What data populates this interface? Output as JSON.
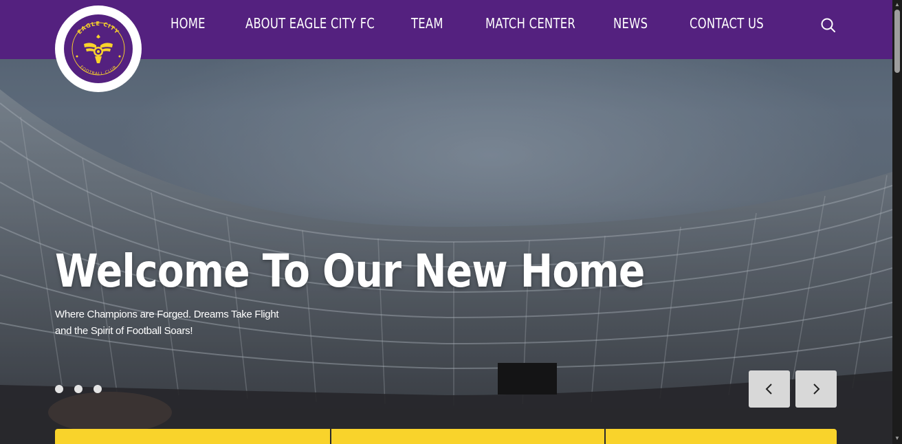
{
  "brand": {
    "name_top": "EAGLE CITY",
    "name_bottom": "FOOTBALL CLUB",
    "colors": {
      "primary": "#54217f",
      "accent": "#f9d32b"
    }
  },
  "nav": {
    "items": [
      {
        "label": "HOME"
      },
      {
        "label": "ABOUT EAGLE CITY FC"
      },
      {
        "label": "TEAM"
      },
      {
        "label": "MATCH CENTER"
      },
      {
        "label": "NEWS"
      },
      {
        "label": "CONTACT US"
      }
    ],
    "search_icon": "search-icon"
  },
  "hero": {
    "title": "Welcome To Our New Home",
    "subtitle_line1": "Where Champions are Forged. Dreams Take Flight",
    "subtitle_line2": "and the Spirit of Football Soars!",
    "slides": 3,
    "prev_icon": "chevron-left-icon",
    "next_icon": "chevron-right-icon"
  }
}
